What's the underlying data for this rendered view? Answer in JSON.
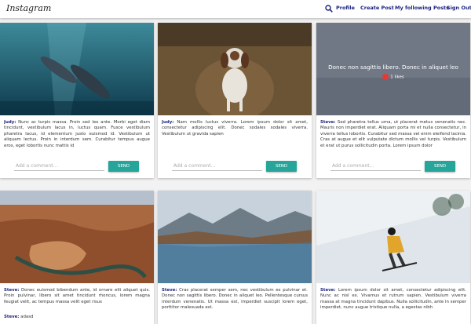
{
  "nav": {
    "logo": "Instagram",
    "links": [
      "Profile",
      "Create Post",
      "My following Posts",
      "Sign Out"
    ]
  },
  "placeholder": "Add a comment...",
  "send_label": "SEND",
  "posts": [
    {
      "user": "Judy:",
      "caption": "Nunc ac turpis massa. Proin sed leo ante. Morbi eget diam tincidunt, vestibulum lacus in, luctus quam. Fusce vestibulum pharetra lacus, id elementum justo euismod id. Vestibulum ut aliquam lectus. Proin in interdum sem. Curabitur tempus augue eros, eget lobortis nunc mattis id"
    },
    {
      "user": "Judy:",
      "caption": "Nam mollis luctus viverra. Lorem ipsum dolor sit amet, consectetur adipiscing elit. Donec sodales sodales viverra. Vestibulum ut gravida sapien"
    },
    {
      "user": "Steve:",
      "caption": "Sed pharetra tellus urna, ut placerat metus venenatis nec. Mauris non imperdiet erat. Aliquam porta mi et nulla consectetur, in viverra tellus lobortis. Curabitur sed massa vel enim eleifend lacinia. Cras at augue et elit vulputate dictum mollis vel turpis. Vestibulum et erat ut purus sollicitudin porta. Lorem ipsum dolor",
      "overlay_text": "Donec non sagittis libero. Donec in aliquet leo",
      "likes": "1 likes"
    },
    {
      "user": "Steve:",
      "caption": "Donec euismod bibendum ante, id ornare elit aliquet quis. Proin pulvinar, libero sit amet tincidunt rhoncus, lorem magna feugiat velit, ac tempus massa velit eget risus",
      "extra_user": "Steve:",
      "extra_text": "adasd"
    },
    {
      "user": "Steve:",
      "caption": "Cras placerat semper sem, nec vestibulum ex pulvinar et. Donec non sagittis libero. Donec in aliquet leo. Pellentesque cursus interdum venenatis. Ut massa est, imperdiet suscipit lorem eget, porttitor malesuada est."
    },
    {
      "user": "Steve:",
      "caption": "Lorem ipsum dolor sit amet, consectetur adipiscing elit. Nunc ac nisl ex. Vivamus et rutrum sapien. Vestibulum viverra massa at magna tincidunt dapibus. Nulla sollicitudin, ante in semper imperdiet, nunc augue tristique nulla, a egestas nibh"
    }
  ],
  "colors": {
    "accent": "#26a69a",
    "username": "#1a237e",
    "like": "#e53935"
  }
}
